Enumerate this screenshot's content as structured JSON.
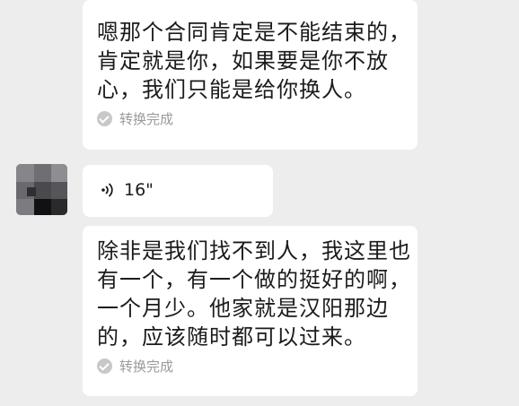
{
  "messages": [
    {
      "lines": [
        "嗯那个合同肯定是不能结束的，",
        "肯定就是你，如果要是你不放",
        "心，我们只能是给你换人。"
      ],
      "status": "转换完成"
    },
    {
      "voice_duration": "16\""
    },
    {
      "lines": [
        "除非是我们找不到人，我这里也",
        "有一个，有一个做的挺好的啊，",
        "一个月少。他家就是汉阳那边",
        "的，应该随时都可以过来。"
      ],
      "status": "转换完成"
    }
  ],
  "icons": {
    "voice": "voice-wave-icon",
    "status": "check-circle-icon",
    "avatar": "pixelated-avatar"
  },
  "colors": {
    "background": "#ededed",
    "bubble": "#ffffff",
    "text": "#1b1b1b",
    "status_text": "#9a9a9a"
  }
}
